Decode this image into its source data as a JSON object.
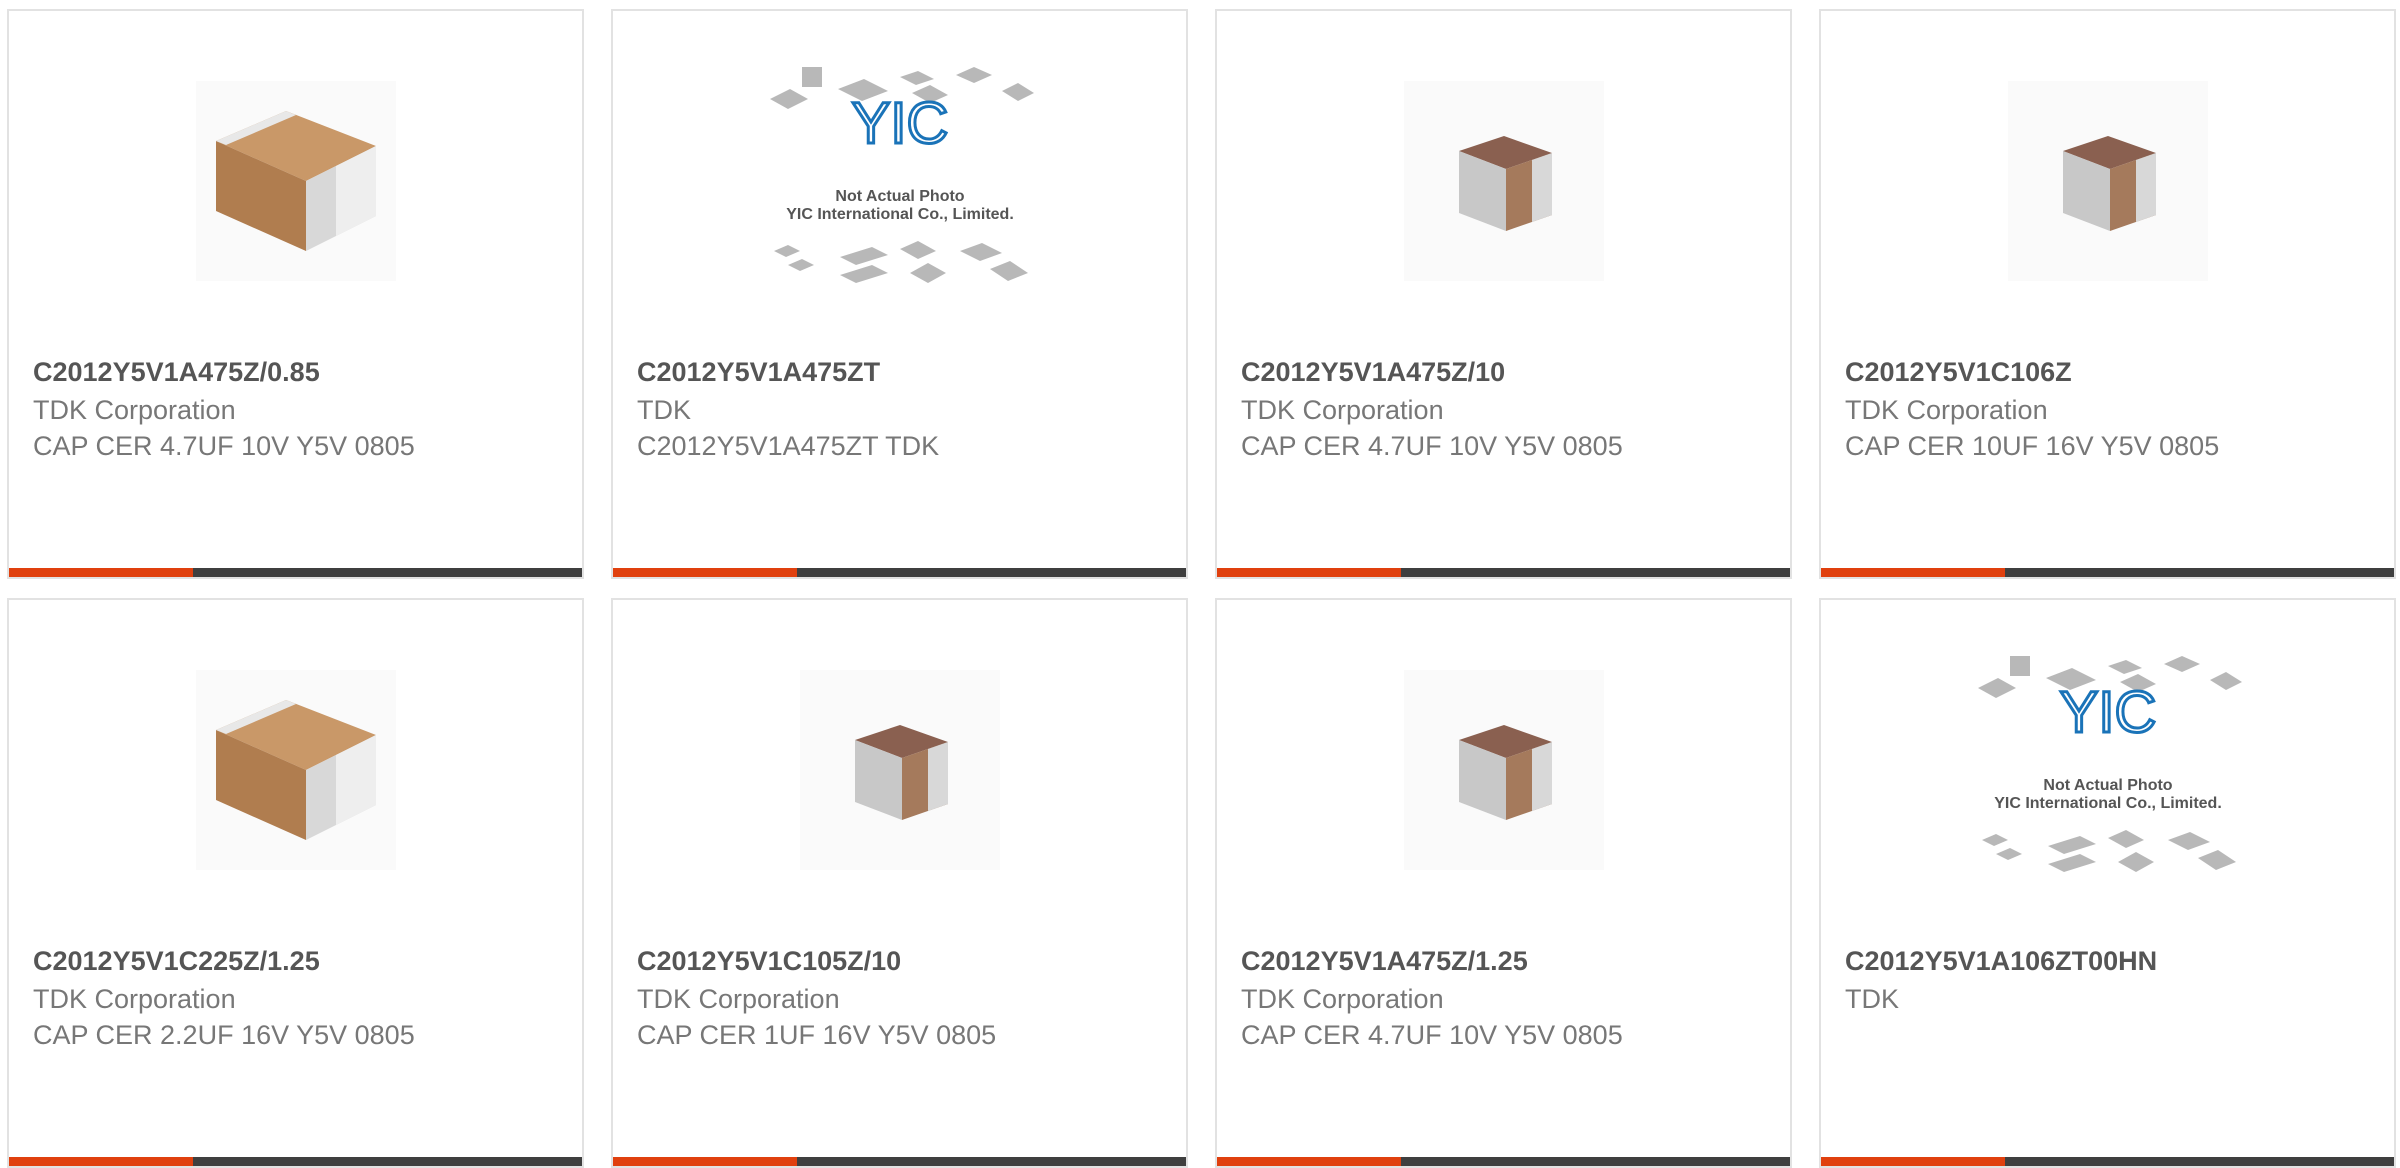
{
  "theme": {
    "accent": "#e0400e",
    "bar": "#3f3f3f"
  },
  "placeholder": {
    "line1": "Not Actual Photo",
    "line2": "YIC International Co., Limited.",
    "logo": "YIC"
  },
  "products": [
    {
      "part": "C2012Y5V1A475Z/0.85",
      "manufacturer": "TDK Corporation",
      "description": "CAP CER 4.7UF 10V Y5V 0805",
      "image": "tan-chip-capacitor"
    },
    {
      "part": "C2012Y5V1A475ZT",
      "manufacturer": "TDK",
      "description": "C2012Y5V1A475ZT TDK",
      "image": "not-actual-photo"
    },
    {
      "part": "C2012Y5V1A475Z/10",
      "manufacturer": "TDK Corporation",
      "description": "CAP CER 4.7UF 10V Y5V 0805",
      "image": "small-chip-capacitor"
    },
    {
      "part": "C2012Y5V1C106Z",
      "manufacturer": "TDK Corporation",
      "description": "CAP CER 10UF 16V Y5V 0805",
      "image": "small-chip-capacitor"
    },
    {
      "part": "C2012Y5V1C225Z/1.25",
      "manufacturer": "TDK Corporation",
      "description": "CAP CER 2.2UF 16V Y5V 0805",
      "image": "tan-chip-capacitor"
    },
    {
      "part": "C2012Y5V1C105Z/10",
      "manufacturer": "TDK Corporation",
      "description": "CAP CER 1UF 16V Y5V 0805",
      "image": "small-chip-capacitor"
    },
    {
      "part": "C2012Y5V1A475Z/1.25",
      "manufacturer": "TDK Corporation",
      "description": "CAP CER 4.7UF 10V Y5V 0805",
      "image": "small-chip-capacitor"
    },
    {
      "part": "C2012Y5V1A106ZT00HN",
      "manufacturer": "TDK",
      "description": "",
      "image": "not-actual-photo"
    }
  ]
}
